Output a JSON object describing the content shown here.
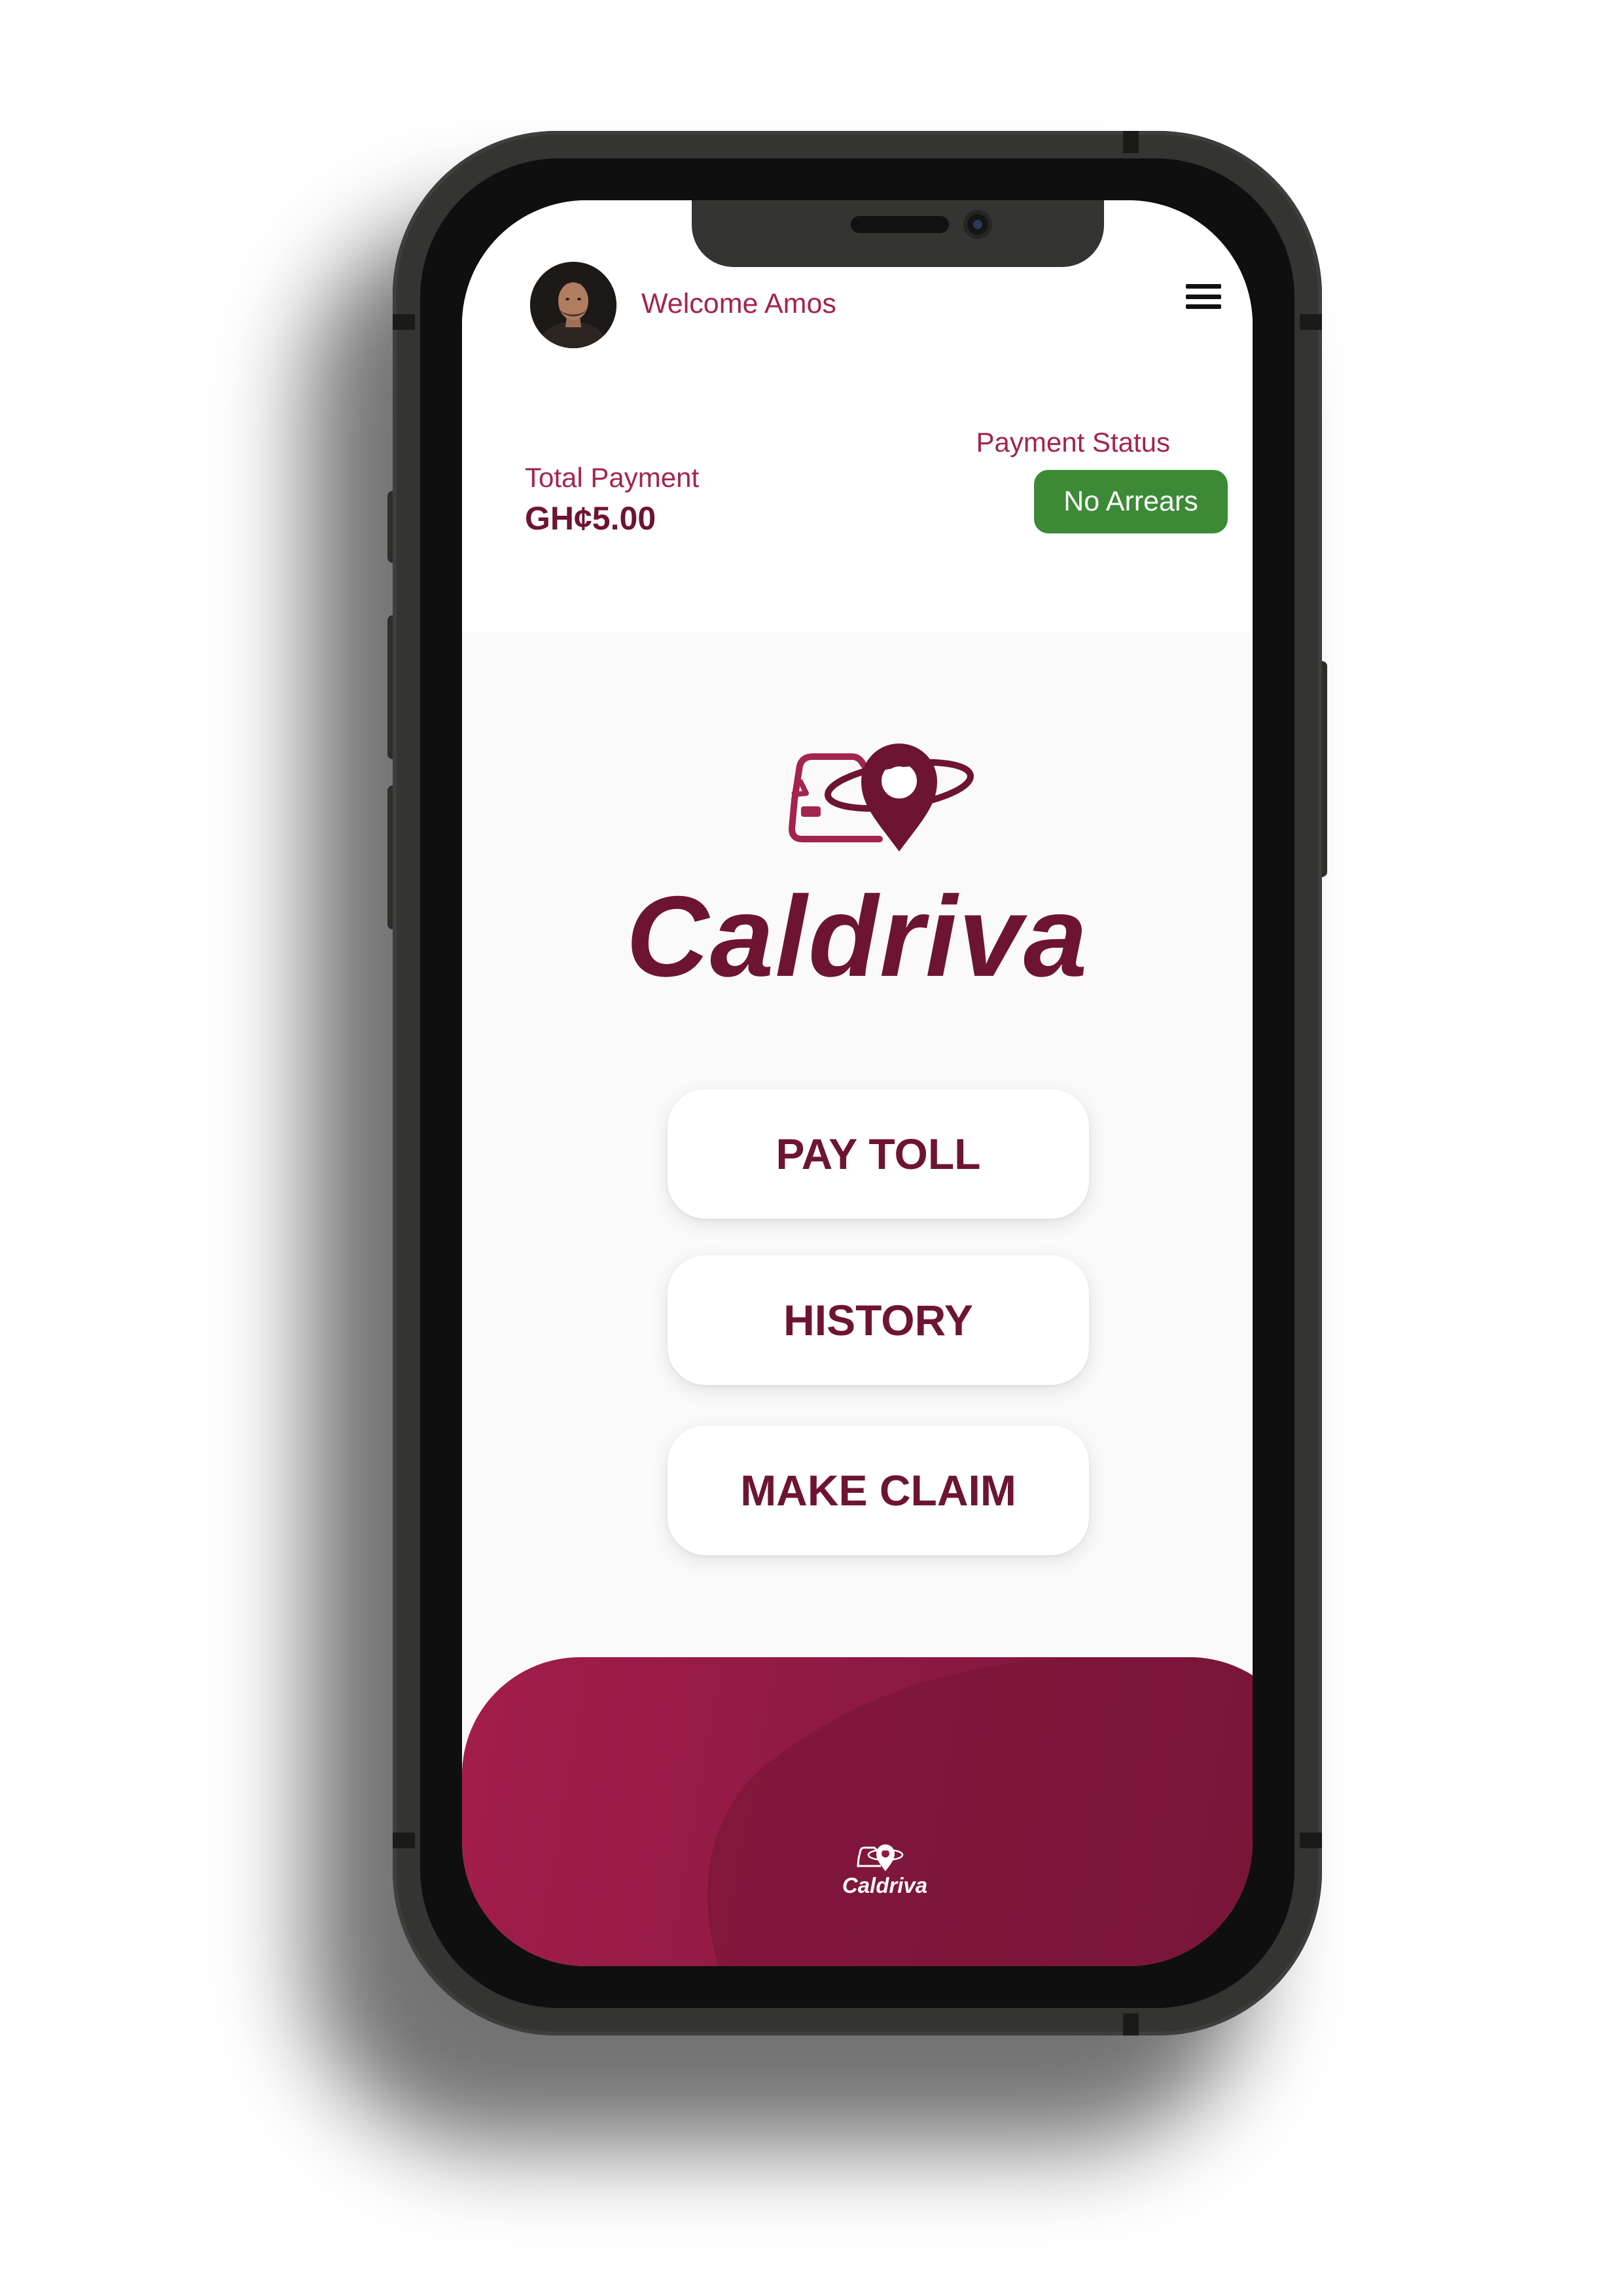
{
  "header": {
    "welcome_text": "Welcome Amos",
    "total_label": "Total Payment",
    "total_value": "GH¢5.00",
    "status_label": "Payment Status",
    "status_value": "No Arrears"
  },
  "brand": {
    "name": "Caldriva",
    "footer_name": "Caldriva"
  },
  "actions": {
    "pay_toll": "PAY TOLL",
    "history": "HISTORY",
    "make_claim": "MAKE CLAIM"
  },
  "colors": {
    "brand": "#6e1433",
    "accent": "#a3244f",
    "status_ok": "#3d8a36"
  },
  "icons": {
    "menu": "hamburger-menu-icon",
    "logo": "car-location-pin-icon"
  }
}
